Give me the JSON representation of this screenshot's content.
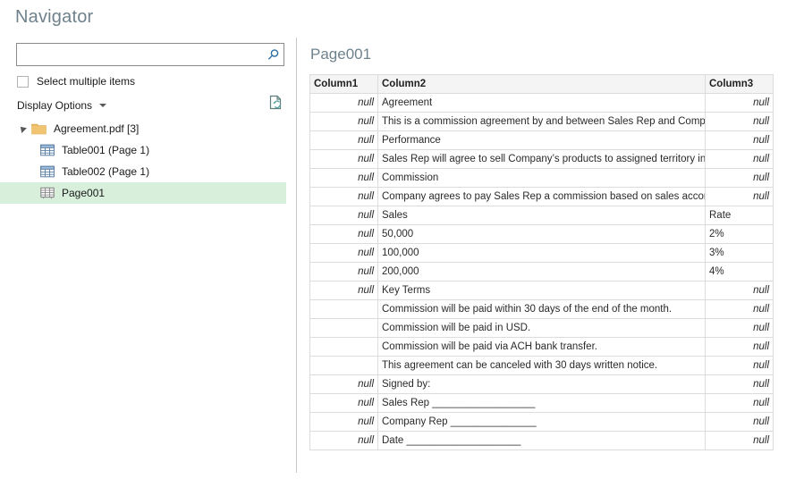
{
  "dialog": {
    "title": "Navigator"
  },
  "search": {
    "value": "",
    "placeholder": "",
    "icon": "search-icon"
  },
  "options": {
    "select_multiple_label": "Select multiple items",
    "select_multiple_checked": false,
    "display_options_label": "Display Options",
    "display_options_caret": "chevron-down-icon",
    "refresh_icon": "page-refresh-icon"
  },
  "tree": {
    "root": {
      "label": "Agreement.pdf [3]",
      "icon": "folder-icon",
      "expanded": true
    },
    "children": [
      {
        "label": "Table001 (Page 1)",
        "icon": "table-icon",
        "selected": false
      },
      {
        "label": "Table002 (Page 1)",
        "icon": "table-icon",
        "selected": false
      },
      {
        "label": "Page001",
        "icon": "page-table-icon",
        "selected": true
      }
    ]
  },
  "preview": {
    "title": "Page001",
    "columns": [
      "Column1",
      "Column2",
      "Column3"
    ],
    "rows": [
      {
        "c1": "null",
        "c1null": true,
        "c2": "Agreement",
        "c3": "null",
        "c3null": true
      },
      {
        "c1": "null",
        "c1null": true,
        "c2": "This is a commission agreement by and between Sales Rep and Company.",
        "c3": "null",
        "c3null": true
      },
      {
        "c1": "null",
        "c1null": true,
        "c2": "Performance",
        "c3": "null",
        "c3null": true
      },
      {
        "c1": "null",
        "c1null": true,
        "c2": "Sales Rep will agree to sell Company’s products to assigned territory in a p",
        "c3": "null",
        "c3null": true
      },
      {
        "c1": "null",
        "c1null": true,
        "c2": "Commission",
        "c3": "null",
        "c3null": true
      },
      {
        "c1": "null",
        "c1null": true,
        "c2": "Company agrees to pay Sales Rep a commission based on sales according ·",
        "c3": "null",
        "c3null": true
      },
      {
        "c1": "null",
        "c1null": true,
        "c2": "Sales",
        "c3": "Rate",
        "c3null": false
      },
      {
        "c1": "null",
        "c1null": true,
        "c2": "50,000",
        "c3": "2%",
        "c3null": false
      },
      {
        "c1": "null",
        "c1null": true,
        "c2": "100,000",
        "c3": "3%",
        "c3null": false
      },
      {
        "c1": "null",
        "c1null": true,
        "c2": "200,000",
        "c3": "4%",
        "c3null": false
      },
      {
        "c1": "null",
        "c1null": true,
        "c2": "Key Terms",
        "c3": "null",
        "c3null": true
      },
      {
        "c1": "",
        "c1null": false,
        "c2": "Commission will be paid within 30 days of the end of the month.",
        "c3": "null",
        "c3null": true
      },
      {
        "c1": "",
        "c1null": false,
        "c2": "Commission will be paid in USD.",
        "c3": "null",
        "c3null": true
      },
      {
        "c1": "",
        "c1null": false,
        "c2": "Commission will be paid via ACH bank transfer.",
        "c3": "null",
        "c3null": true
      },
      {
        "c1": "",
        "c1null": false,
        "c2": "This agreement can be canceled with 30 days written notice.",
        "c3": "null",
        "c3null": true
      },
      {
        "c1": "null",
        "c1null": true,
        "c2": "Signed by:",
        "c3": "null",
        "c3null": true
      },
      {
        "c1": "null",
        "c1null": true,
        "c2": "Sales Rep __________________",
        "c3": "null",
        "c3null": true
      },
      {
        "c1": "null",
        "c1null": true,
        "c2": "Company Rep _______________",
        "c3": "null",
        "c3null": true
      },
      {
        "c1": "null",
        "c1null": true,
        "c2": "Date ____________________",
        "c3": "null",
        "c3null": true
      }
    ]
  },
  "colors": {
    "title": "#6f828c",
    "selection": "#d8efdc",
    "header_bg": "#f4f4f4",
    "border": "#dcdcdc",
    "accent": "#2b6ca3",
    "folder": "#e8b96a"
  }
}
